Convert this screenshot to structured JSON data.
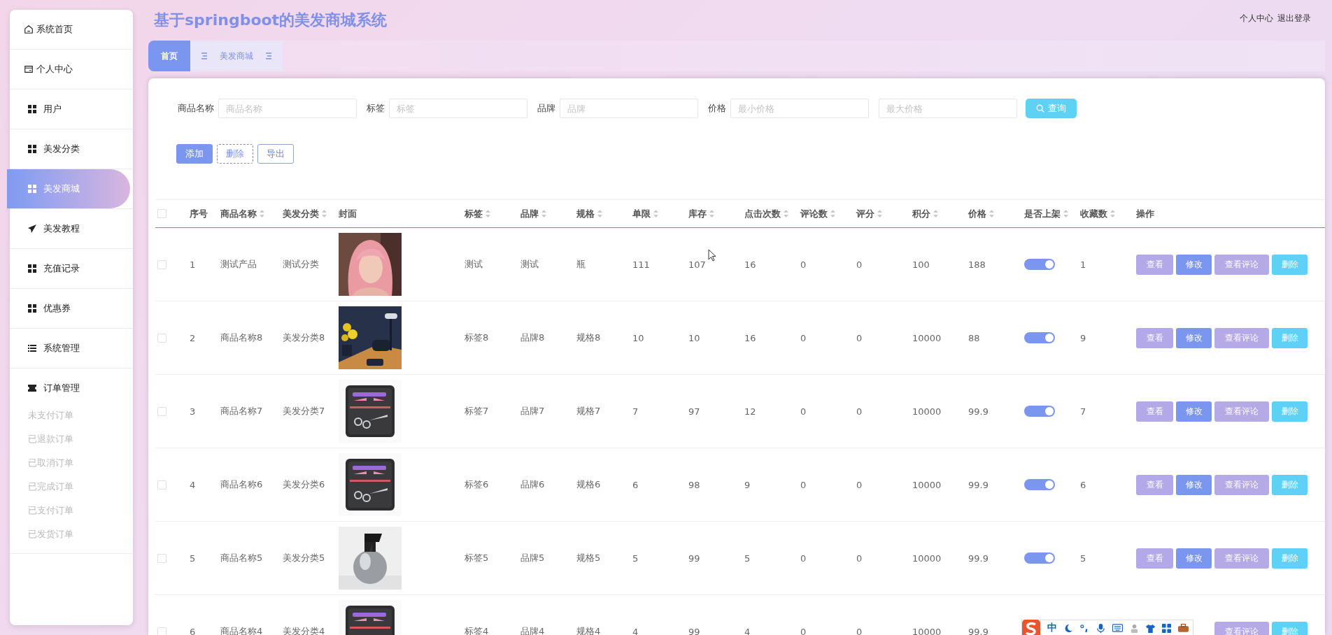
{
  "header": {
    "title": "基于springboot的美发商城系统",
    "links": [
      "个人中心",
      "退出登录"
    ]
  },
  "sidebar": {
    "items": [
      {
        "label": "系统首页",
        "selected": false
      },
      {
        "label": "个人中心",
        "selected": false
      },
      {
        "label": "用户",
        "selected": false
      },
      {
        "label": "美发分类",
        "selected": false
      },
      {
        "label": "美发商城",
        "selected": true
      },
      {
        "label": "美发教程",
        "selected": false
      },
      {
        "label": "充值记录",
        "selected": false
      },
      {
        "label": "优惠券",
        "selected": false
      },
      {
        "label": "系统管理",
        "selected": false
      },
      {
        "label": "订单管理",
        "selected": false,
        "expanded": true,
        "children": [
          {
            "label": "未支付订单"
          },
          {
            "label": "已退款订单"
          },
          {
            "label": "已取消订单"
          },
          {
            "label": "已完成订单"
          },
          {
            "label": "已支付订单"
          },
          {
            "label": "已发货订单"
          }
        ]
      }
    ]
  },
  "tabs": [
    {
      "label": "首页",
      "selected": true
    },
    {
      "label": "美发商城",
      "selected": false
    }
  ],
  "search": {
    "fields": [
      {
        "label": "商品名称",
        "placeholder": "商品名称"
      },
      {
        "label": "标签",
        "placeholder": "标签"
      },
      {
        "label": "品牌",
        "placeholder": "品牌"
      },
      {
        "label": "价格",
        "placeholder": "最小价格"
      },
      {
        "placeholder": "最大价格"
      }
    ],
    "button": "查询"
  },
  "toolbar": [
    {
      "label": "添加",
      "kind": "primary"
    },
    {
      "label": "删除",
      "kind": "dashed"
    },
    {
      "label": "导出",
      "kind": "outline"
    }
  ],
  "table": {
    "select_all": {
      "checked": false
    },
    "columns": [
      {
        "label": "序号",
        "kind": "text",
        "sortable": false
      },
      {
        "label": "商品名称",
        "kind": "text",
        "sortable": true
      },
      {
        "label": "美发分类",
        "kind": "text",
        "sortable": true
      },
      {
        "label": "封面",
        "kind": "picture",
        "sortable": false
      },
      {
        "label": "标签",
        "kind": "text",
        "sortable": true
      },
      {
        "label": "品牌",
        "kind": "text",
        "sortable": true
      },
      {
        "label": "规格",
        "kind": "text",
        "sortable": true
      },
      {
        "label": "单限",
        "kind": "text",
        "sortable": true
      },
      {
        "label": "库存",
        "kind": "text",
        "sortable": true
      },
      {
        "label": "点击次数",
        "kind": "text",
        "sortable": true
      },
      {
        "label": "评论数",
        "kind": "text",
        "sortable": true
      },
      {
        "label": "评分",
        "kind": "text",
        "sortable": true
      },
      {
        "label": "积分",
        "kind": "text",
        "sortable": true
      },
      {
        "label": "价格",
        "kind": "text",
        "sortable": true
      },
      {
        "label": "是否上架",
        "kind": "switch",
        "sortable": true
      },
      {
        "label": "收藏数",
        "kind": "text",
        "sortable": true
      },
      {
        "label": "操作",
        "kind": "actions",
        "sortable": false
      }
    ],
    "rows": [
      {
        "checked": false,
        "cells": [
          "1",
          "测试产品",
          "测试分类",
          "",
          "测试",
          "测试",
          "瓶",
          "111",
          "107",
          "16",
          "0",
          "0",
          "100",
          "188",
          "",
          "1",
          ""
        ],
        "on": true,
        "cover": {
          "kind": "picture"
        },
        "actions": [
          {
            "label": "查看",
            "kind": "view"
          },
          {
            "label": "修改",
            "kind": "edit"
          },
          {
            "label": "查看评论",
            "kind": "comments"
          },
          {
            "label": "删除",
            "kind": "delete"
          }
        ]
      },
      {
        "checked": false,
        "cells": [
          "2",
          "商品名称8",
          "美发分类8",
          "",
          "标签8",
          "品牌8",
          "规格8",
          "10",
          "10",
          "16",
          "0",
          "0",
          "10000",
          "88",
          "",
          "9",
          ""
        ],
        "on": true,
        "cover": {
          "kind": "picture"
        },
        "actions": [
          {
            "label": "查看",
            "kind": "view"
          },
          {
            "label": "修改",
            "kind": "edit"
          },
          {
            "label": "查看评论",
            "kind": "comments"
          },
          {
            "label": "删除",
            "kind": "delete"
          }
        ]
      },
      {
        "checked": false,
        "cells": [
          "3",
          "商品名称7",
          "美发分类7",
          "",
          "标签7",
          "品牌7",
          "规格7",
          "7",
          "97",
          "12",
          "0",
          "0",
          "10000",
          "99.9",
          "",
          "7",
          ""
        ],
        "on": true,
        "cover": {
          "kind": "picture"
        },
        "actions": [
          {
            "label": "查看",
            "kind": "view"
          },
          {
            "label": "修改",
            "kind": "edit"
          },
          {
            "label": "查看评论",
            "kind": "comments"
          },
          {
            "label": "删除",
            "kind": "delete"
          }
        ]
      },
      {
        "checked": false,
        "cells": [
          "4",
          "商品名称6",
          "美发分类6",
          "",
          "标签6",
          "品牌6",
          "规格6",
          "6",
          "98",
          "9",
          "0",
          "0",
          "10000",
          "99.9",
          "",
          "6",
          ""
        ],
        "on": true,
        "cover": {
          "kind": "picture"
        },
        "actions": [
          {
            "label": "查看",
            "kind": "view"
          },
          {
            "label": "修改",
            "kind": "edit"
          },
          {
            "label": "查看评论",
            "kind": "comments"
          },
          {
            "label": "删除",
            "kind": "delete"
          }
        ]
      },
      {
        "checked": false,
        "cells": [
          "5",
          "商品名称5",
          "美发分类5",
          "",
          "标签5",
          "品牌5",
          "规格5",
          "5",
          "99",
          "5",
          "0",
          "0",
          "10000",
          "99.9",
          "",
          "5",
          ""
        ],
        "on": true,
        "cover": {
          "kind": "picture"
        },
        "actions": [
          {
            "label": "查看",
            "kind": "view"
          },
          {
            "label": "修改",
            "kind": "edit"
          },
          {
            "label": "查看评论",
            "kind": "comments"
          },
          {
            "label": "删除",
            "kind": "delete"
          }
        ]
      },
      {
        "checked": false,
        "cells": [
          "6",
          "商品名称4",
          "美发分类4",
          "",
          "标签4",
          "品牌4",
          "规格4",
          "4",
          "99",
          "4",
          "0",
          "0",
          "10000",
          "99.9",
          "",
          "",
          ""
        ],
        "cover": {
          "kind": "picture"
        },
        "actions": [
          {
            "label": "查看评论",
            "kind": "comments"
          },
          {
            "label": "删除",
            "kind": "delete"
          }
        ]
      }
    ]
  },
  "ime_toolbar": {
    "mode": "中"
  }
}
